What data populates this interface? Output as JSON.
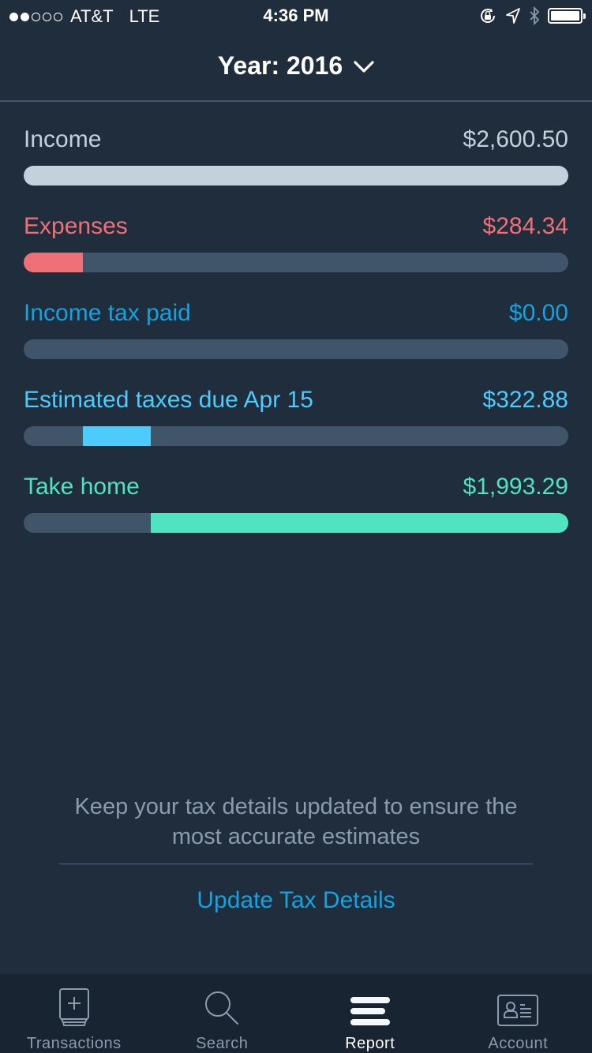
{
  "status_bar": {
    "signal_bars_filled": 2,
    "signal_bars_total": 5,
    "carrier": "AT&T",
    "network": "LTE",
    "time": "4:36 PM",
    "battery_level": 1.0
  },
  "header": {
    "title": "Year: 2016"
  },
  "colors": {
    "background": "#1f2d3d",
    "track": "#40546a",
    "income": "#c3d1dc",
    "expenses": "#f07077",
    "income_tax_paid": "#14a3e0",
    "estimated_taxes": "#4ccbfc",
    "take_home": "#50e3c2",
    "link": "#14a3e0"
  },
  "metrics": [
    {
      "label": "Income",
      "value": "$2,600.50",
      "amount": 2600.5,
      "color": "#c3d1dc",
      "label_color": "#c3d1dc",
      "fill_start": 0.0,
      "fill_fraction": 1.0
    },
    {
      "label": "Expenses",
      "value": "$284.34",
      "amount": 284.34,
      "color": "#f07077",
      "label_color": "#f07077",
      "fill_start": 0.0,
      "fill_fraction": 0.1093
    },
    {
      "label": "Income tax paid",
      "value": "$0.00",
      "amount": 0.0,
      "color": "#14a3e0",
      "label_color": "#14a3e0",
      "fill_start": 0.1093,
      "fill_fraction": 0.0
    },
    {
      "label": "Estimated taxes due Apr 15",
      "value": "$322.88",
      "amount": 322.88,
      "color": "#4ccbfc",
      "label_color": "#4ccbfc",
      "fill_start": 0.1093,
      "fill_fraction": 0.1242
    },
    {
      "label": "Take home",
      "value": "$1,993.29",
      "amount": 1993.29,
      "color": "#50e3c2",
      "label_color": "#50e3c2",
      "fill_start": 0.2335,
      "fill_fraction": 0.7665
    }
  ],
  "footer": {
    "note": "Keep your tax details updated to ensure the most accurate estimates",
    "update_link": "Update Tax Details"
  },
  "tabs": [
    {
      "label": "Transactions",
      "icon": "add-transaction-icon",
      "active": false
    },
    {
      "label": "Search",
      "icon": "search-icon",
      "active": false
    },
    {
      "label": "Report",
      "icon": "report-icon",
      "active": true
    },
    {
      "label": "Account",
      "icon": "account-card-icon",
      "active": false
    }
  ]
}
